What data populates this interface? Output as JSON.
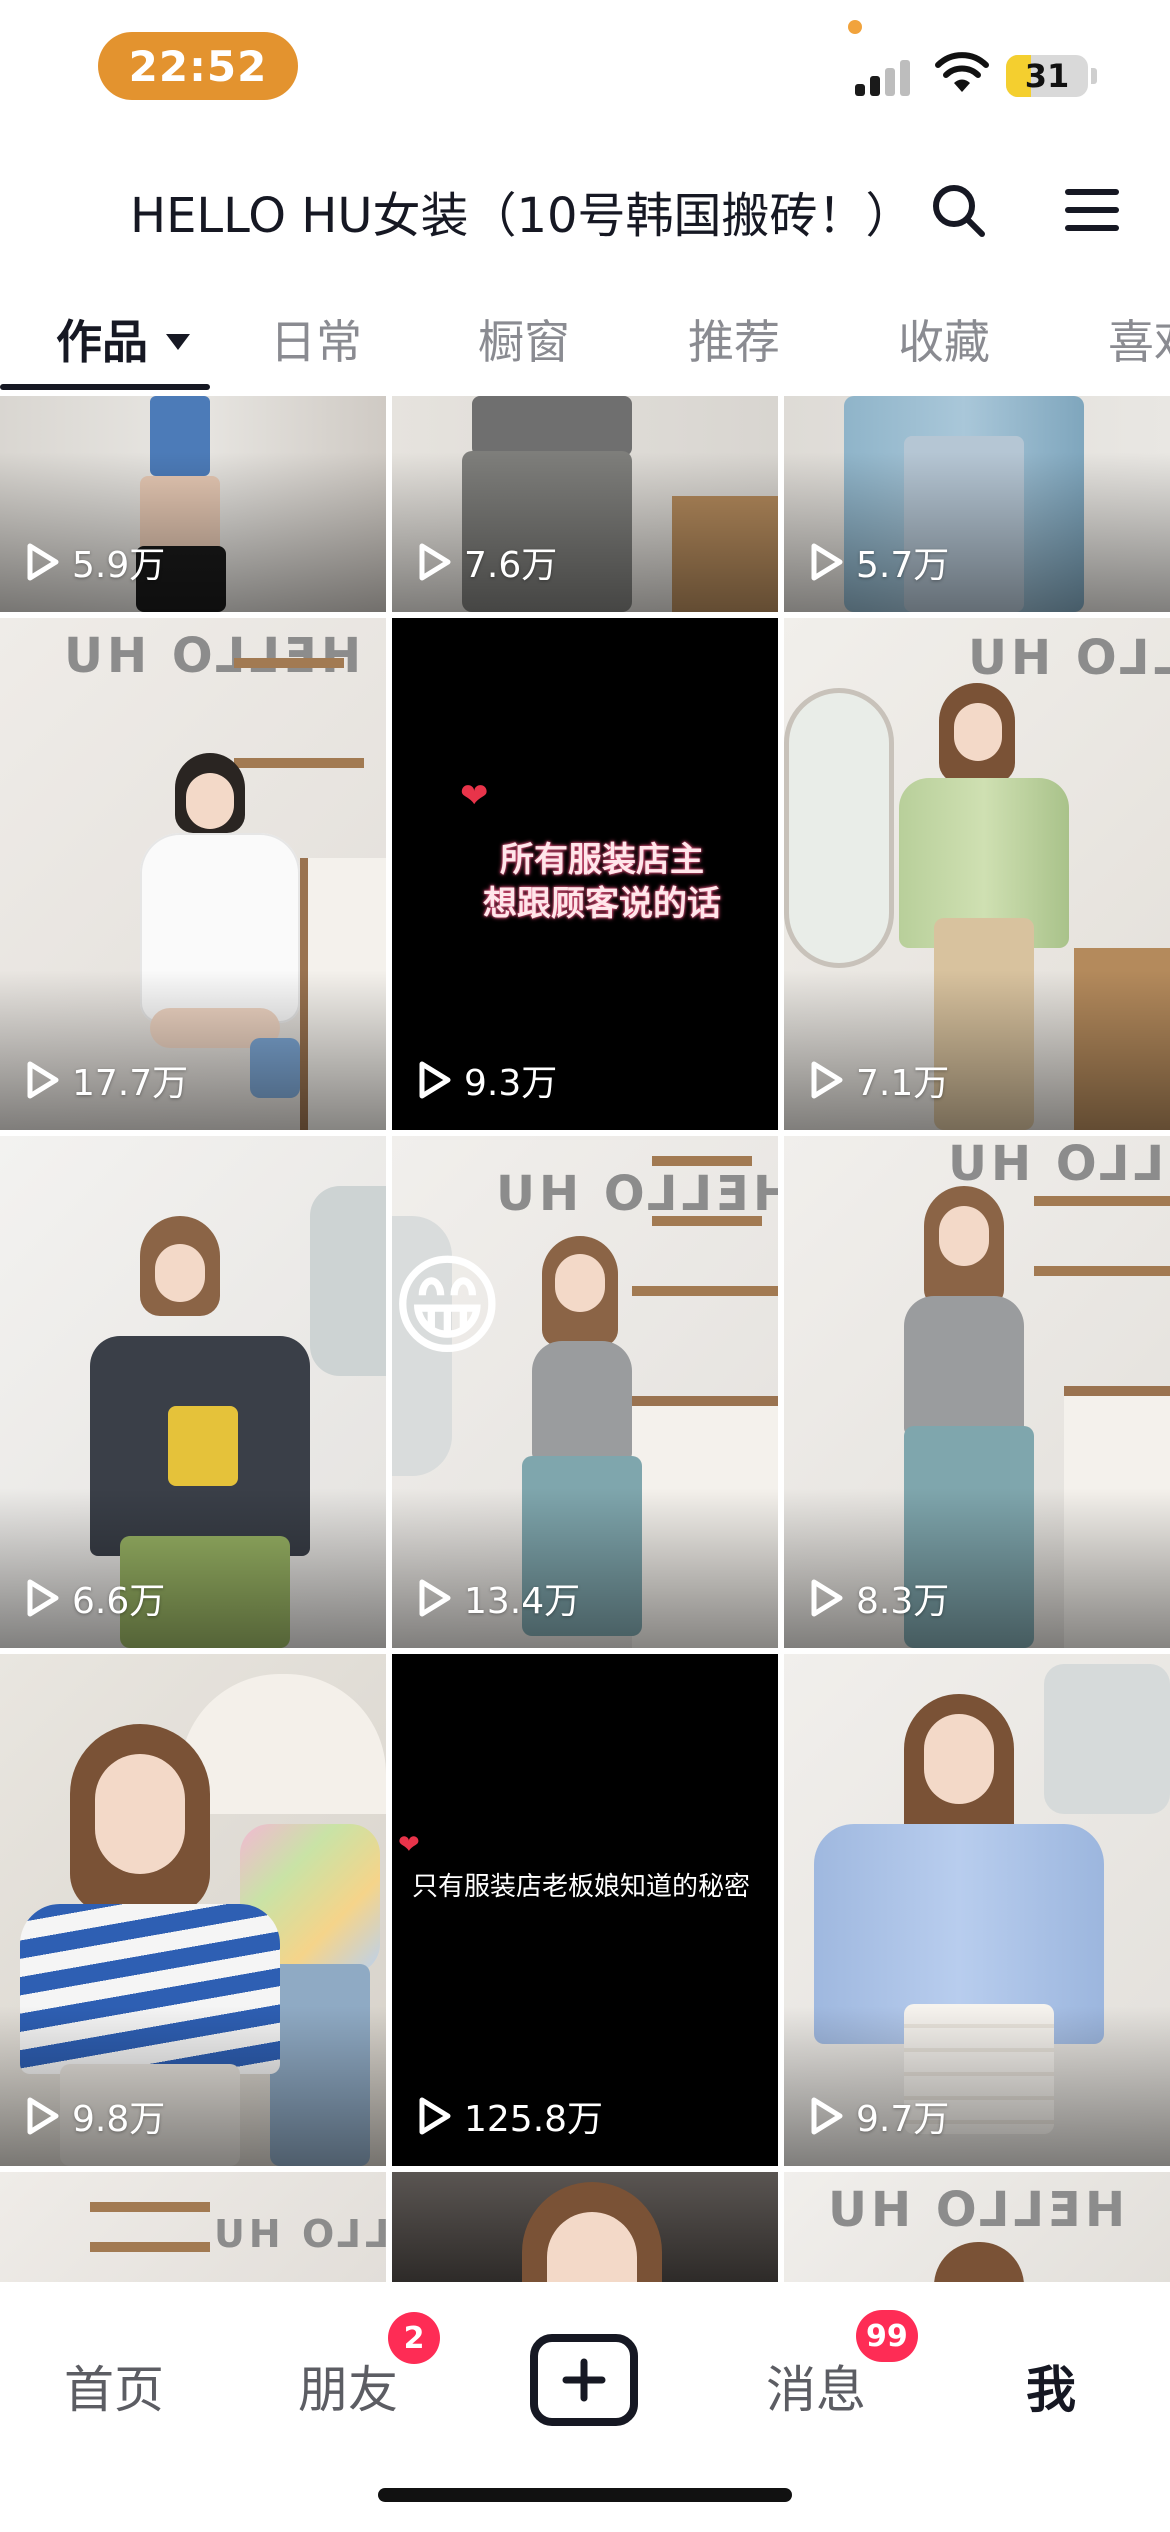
{
  "status_bar": {
    "time": "22:52",
    "battery_percent": 31,
    "battery_label": "31",
    "accent_color": "#e3932f"
  },
  "header": {
    "title": "HELLO HU女装（10号韩国搬砖！）",
    "search_icon": "search-icon",
    "menu_icon": "hamburger-menu-icon"
  },
  "tabs": [
    {
      "label": "作品",
      "active": true
    },
    {
      "label": "日常",
      "active": false
    },
    {
      "label": "橱窗",
      "active": false
    },
    {
      "label": "推荐",
      "active": false
    },
    {
      "label": "收藏",
      "active": false
    },
    {
      "label": "喜欢",
      "active": false
    }
  ],
  "videos": [
    {
      "views": "5.9万"
    },
    {
      "views": "7.6万"
    },
    {
      "views": "5.7万"
    },
    {
      "views": "17.7万"
    },
    {
      "views": "9.3万",
      "caption": "所有服装店主\n想跟顾客说的话"
    },
    {
      "views": "7.1万"
    },
    {
      "views": "6.6万"
    },
    {
      "views": "13.4万",
      "emoji": "😁"
    },
    {
      "views": "8.3万"
    },
    {
      "views": "9.8万"
    },
    {
      "views": "125.8万",
      "caption": "只有服装店老板娘知道的秘密"
    },
    {
      "views": "9.7万"
    },
    {
      "views": ""
    },
    {
      "views": ""
    },
    {
      "views": ""
    }
  ],
  "wall_sign": "HELLO HU",
  "bottom_nav": {
    "home": "首页",
    "friends": "朋友",
    "friends_badge": "2",
    "create_icon": "plus-icon",
    "messages": "消息",
    "messages_badge": "99",
    "me": "我"
  }
}
